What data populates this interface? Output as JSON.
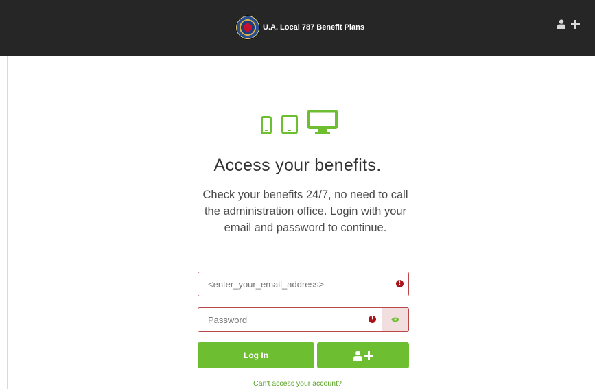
{
  "header": {
    "brand_title": "U.A. Local 787 Benefit Plans",
    "icons": [
      "seal-logo",
      "user-plus-icon"
    ]
  },
  "hero": {
    "device_icons": [
      "phone-icon",
      "tablet-icon",
      "desktop-icon"
    ],
    "title": "Access your benefits.",
    "description": "Check your benefits 24/7, no need to call the administration office. Login with your email and password to continue."
  },
  "login": {
    "email_placeholder": "<enter_your_email_address>",
    "email_value": "",
    "password_placeholder": "Password",
    "password_value": "",
    "login_label": "Log In",
    "register_icon": "user-plus-icon",
    "help_link": "Can't access your account?"
  },
  "colors": {
    "header_bg": "#262626",
    "accent_green": "#6ebe31",
    "error_red": "#a9141a",
    "error_border": "#b9484a",
    "eye_bg": "#f2dede"
  }
}
